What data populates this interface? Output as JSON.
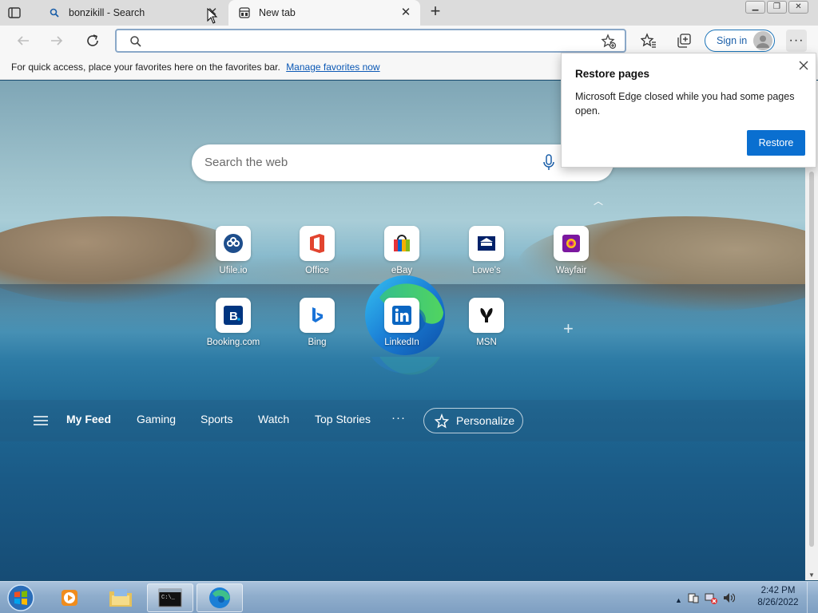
{
  "window": {
    "tabs": [
      {
        "title": "bonzikill - Search",
        "icon": "search-icon"
      },
      {
        "title": "New tab",
        "icon": "newtab-page-icon"
      }
    ]
  },
  "toolbar": {
    "address_value": "",
    "sign_in_label": "Sign in",
    "more_label": "···"
  },
  "favbar": {
    "message": "For quick access, place your favorites here on the favorites bar.",
    "link": "Manage favorites now"
  },
  "search": {
    "placeholder": "Search the web"
  },
  "quick_links": [
    {
      "label": "Ufile.io",
      "icon": "ufile-icon"
    },
    {
      "label": "Office",
      "icon": "office-icon"
    },
    {
      "label": "eBay",
      "icon": "ebay-icon"
    },
    {
      "label": "Lowe's",
      "icon": "lowes-icon"
    },
    {
      "label": "Wayfair",
      "icon": "wayfair-icon"
    },
    {
      "label": "Booking.com",
      "icon": "booking-icon"
    },
    {
      "label": "Bing",
      "icon": "bing-icon"
    },
    {
      "label": "LinkedIn",
      "icon": "linkedin-icon"
    },
    {
      "label": "MSN",
      "icon": "msn-icon"
    }
  ],
  "feed": {
    "items": [
      "My Feed",
      "Gaming",
      "Sports",
      "Watch",
      "Top Stories"
    ],
    "more": "···",
    "personalize": "Personalize"
  },
  "popup": {
    "title": "Restore pages",
    "message": "Microsoft Edge closed while you had some pages open.",
    "button": "Restore"
  },
  "taskbar": {
    "time": "2:42 PM",
    "date": "8/26/2022"
  },
  "colors": {
    "accent": "#0a6fd0",
    "link": "#0b58b5"
  }
}
